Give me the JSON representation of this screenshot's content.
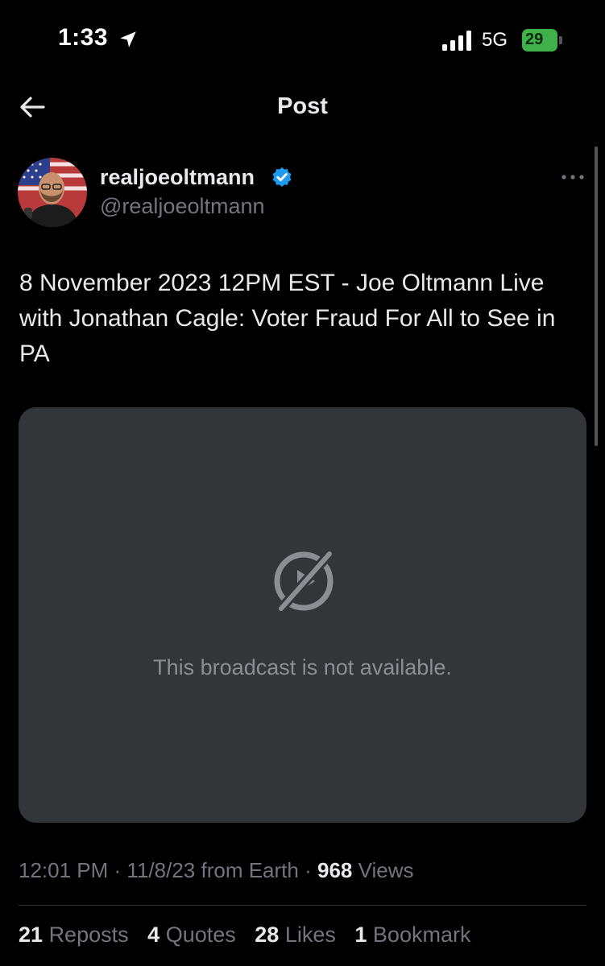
{
  "status_bar": {
    "time": "1:33",
    "network": "5G",
    "battery": "29"
  },
  "header": {
    "title": "Post"
  },
  "post": {
    "display_name": "realjoeoltmann",
    "handle": "@realjoeoltmann",
    "text": "8 November 2023 12PM EST - Joe Oltmann Live with Jonathan Cagle: Voter Fraud For All to See in PA",
    "media_message": "This broadcast is not available.",
    "time": "12:01 PM",
    "date": "11/8/23",
    "source": "from Earth",
    "views_count": "968",
    "views_label": "Views"
  },
  "stats": {
    "reposts_count": "21",
    "reposts_label": "Reposts",
    "quotes_count": "4",
    "quotes_label": "Quotes",
    "likes_count": "28",
    "likes_label": "Likes",
    "bookmarks_count": "1",
    "bookmarks_label": "Bookmark"
  },
  "icons": {
    "back": "arrow-left-icon",
    "location": "location-arrow-icon",
    "signal": "cellular-signal-icon",
    "battery": "battery-icon",
    "verified": "verified-badge-icon",
    "more": "more-horizontal-icon",
    "media": "broadcast-unavailable-icon"
  },
  "colors": {
    "background": "#000000",
    "text": "#e7e9ea",
    "muted": "#71767b",
    "verified": "#1d9bf0",
    "media_bg": "#333639",
    "battery": "#3fb04a"
  }
}
